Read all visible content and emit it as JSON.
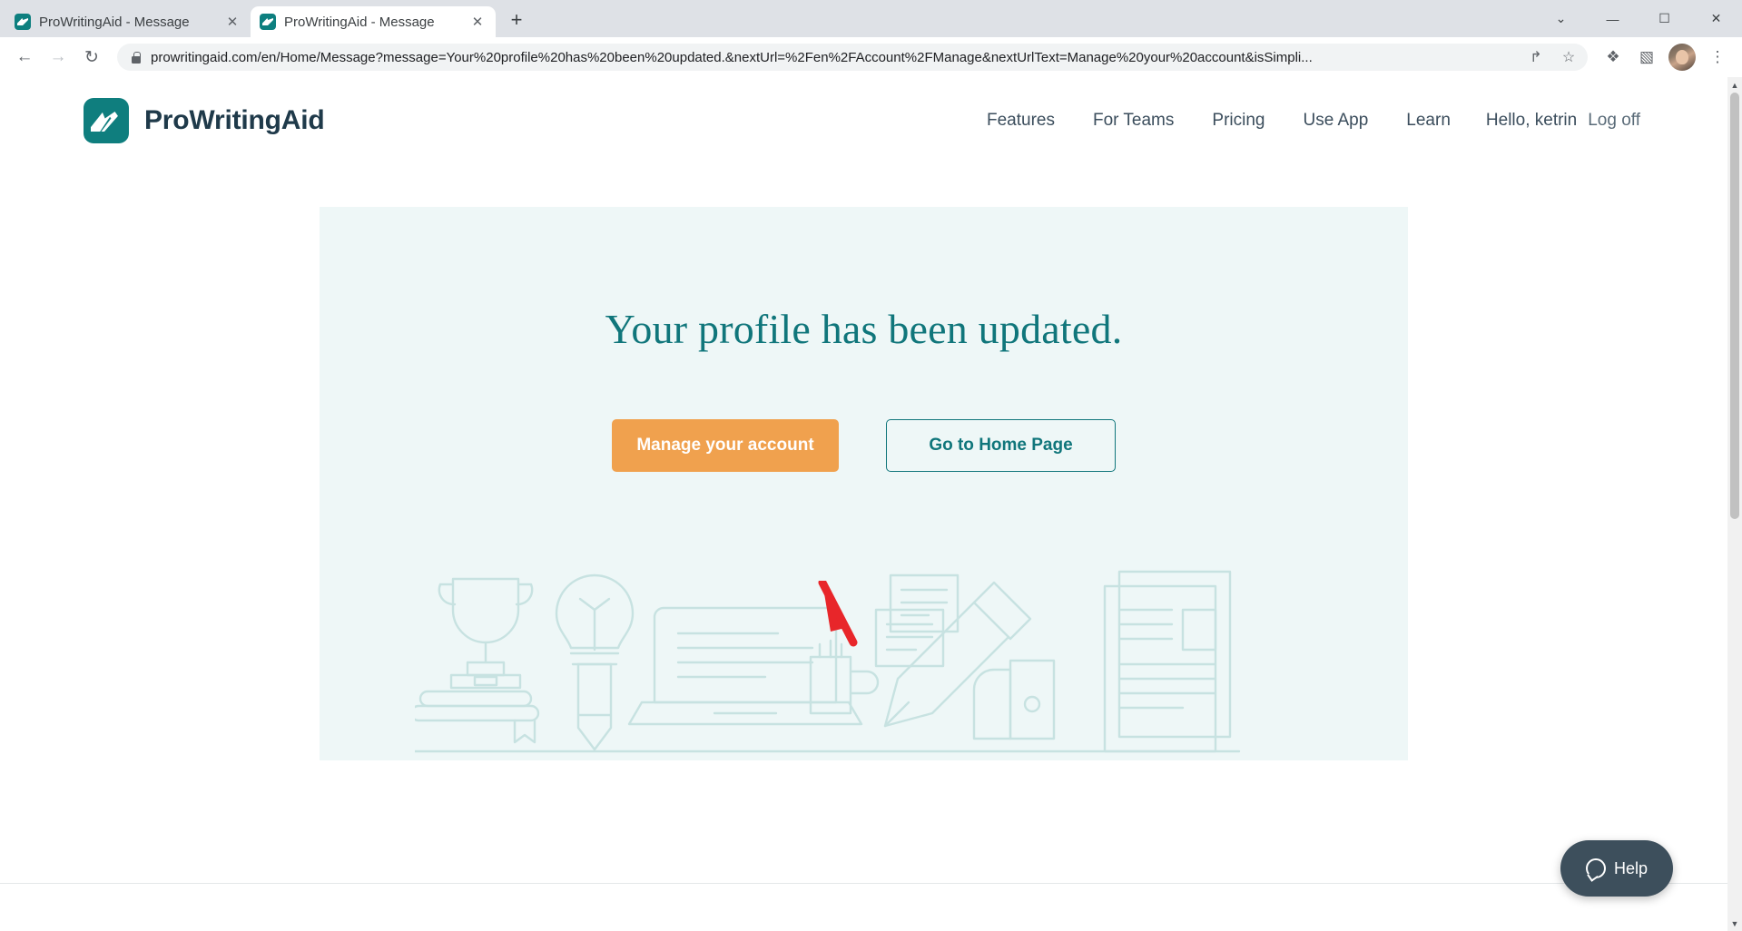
{
  "browser": {
    "tabs": [
      {
        "title": "ProWritingAid - Message",
        "active": false,
        "favicon": "prowritingaid-favicon",
        "close_label": "✕"
      },
      {
        "title": "ProWritingAid - Message",
        "active": true,
        "favicon": "prowritingaid-favicon",
        "close_label": "✕"
      }
    ],
    "new_tab_label": "+",
    "window_controls": {
      "minimize": "—",
      "maximize": "☐",
      "close": "✕",
      "chevron": "⌄"
    },
    "nav": {
      "back": "←",
      "forward": "→",
      "reload": "↻"
    },
    "omnibox": {
      "security_icon": "lock-icon",
      "url": "prowritingaid.com/en/Home/Message?message=Your%20profile%20has%20been%20updated.&nextUrl=%2Fen%2FAccount%2FManage&nextUrlText=Manage%20your%20account&isSimpli...",
      "share_icon": "↱",
      "bookmark_icon": "☆"
    },
    "toolbar_icons": {
      "extensions": "❖",
      "sidepanel": "▧",
      "profile": "avatar",
      "menu": "⋮"
    }
  },
  "site": {
    "brand": {
      "name": "ProWritingAid",
      "logo": "prowritingaid-logo"
    },
    "nav_links": [
      {
        "label": "Features"
      },
      {
        "label": "For Teams"
      },
      {
        "label": "Pricing"
      },
      {
        "label": "Use App"
      },
      {
        "label": "Learn"
      }
    ],
    "account": {
      "greeting": "Hello, ketrin",
      "logoff": "Log off"
    }
  },
  "hero": {
    "title": "Your profile has been updated.",
    "primary_button": "Manage your account",
    "secondary_button": "Go to Home Page",
    "background_color": "#eef7f7",
    "title_color": "#10767b",
    "primary_color": "#f0a14e",
    "secondary_border_color": "#10767b",
    "illustration": "writing-desk-illustration"
  },
  "help_widget": {
    "label": "Help",
    "icon": "chat-bubble-icon",
    "color": "#3d4f5c"
  },
  "annotation": {
    "type": "red-arrow-pointer",
    "color": "#e8262a",
    "points_to": "Manage your account"
  }
}
